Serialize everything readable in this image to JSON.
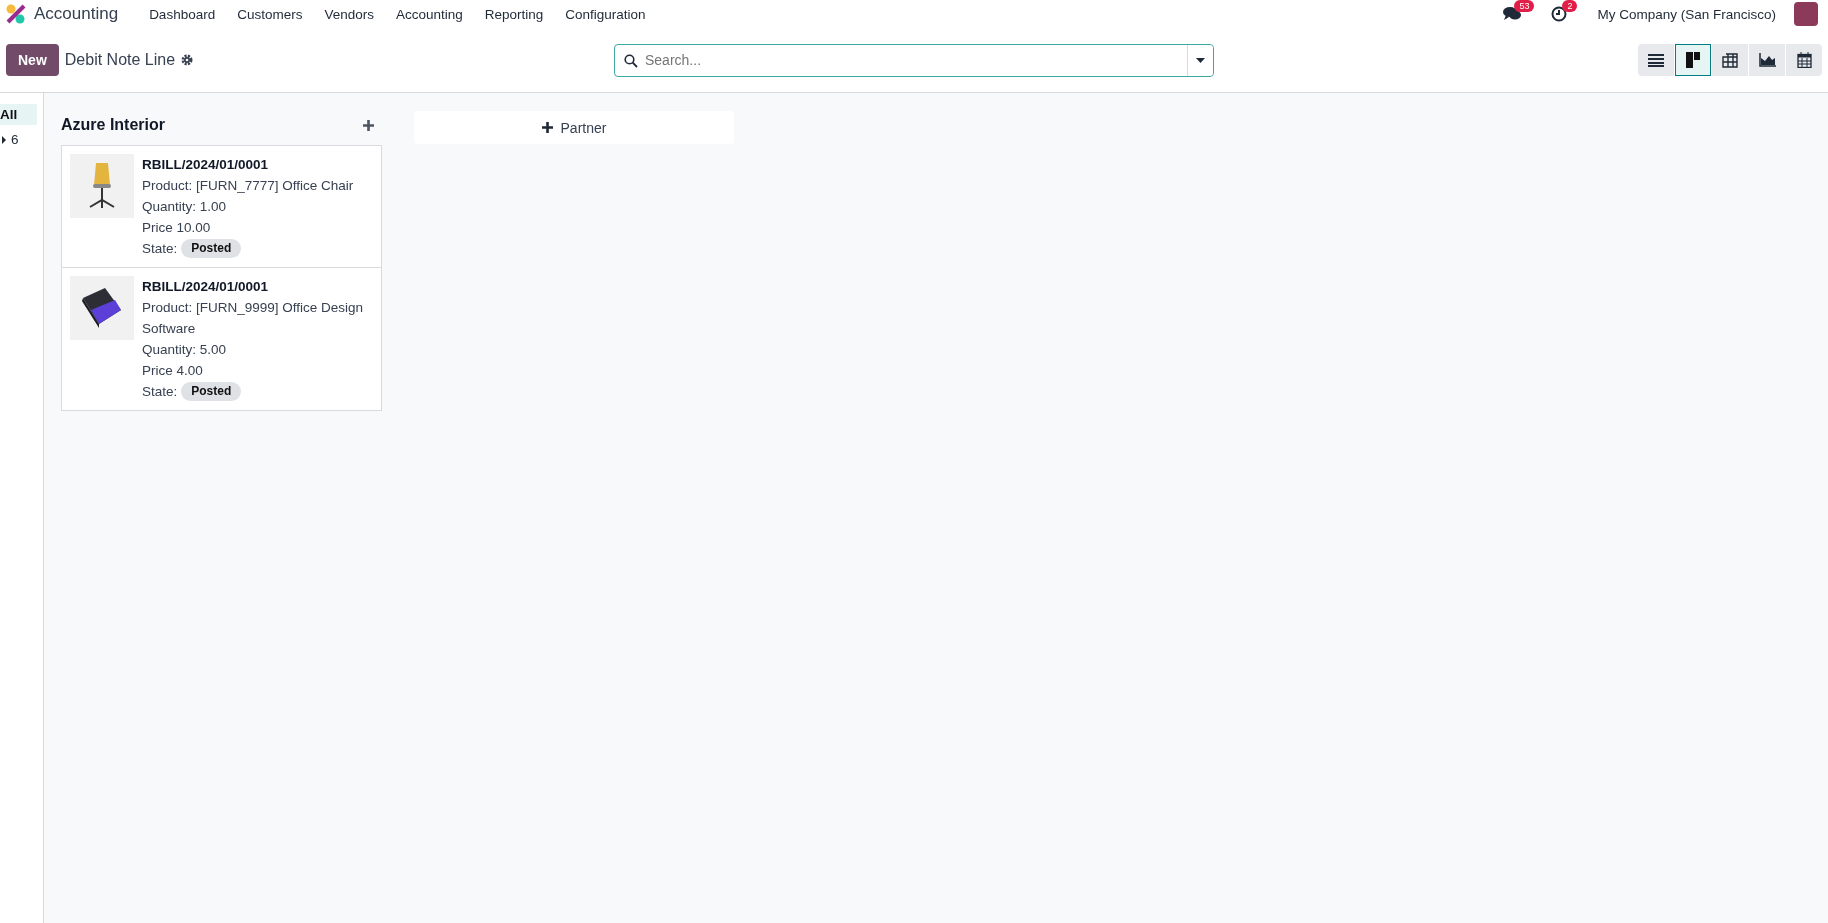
{
  "navbar": {
    "app_name": "Accounting",
    "menu": [
      "Dashboard",
      "Customers",
      "Vendors",
      "Accounting",
      "Reporting",
      "Configuration"
    ],
    "messages_count": "53",
    "activities_count": "2",
    "company": "My Company (San Francisco)"
  },
  "control_panel": {
    "new_button": "New",
    "title": "Debit Note Line",
    "search": {
      "placeholder": "Search..."
    },
    "views": [
      {
        "kind": "list",
        "selected": false
      },
      {
        "kind": "kanban",
        "selected": true
      },
      {
        "kind": "pivot",
        "selected": false
      },
      {
        "kind": "graph",
        "selected": false
      },
      {
        "kind": "calendar",
        "selected": false
      }
    ]
  },
  "sidebar": {
    "items": [
      {
        "label": "All",
        "selected": true,
        "expandable": false
      },
      {
        "label": "6",
        "selected": false,
        "expandable": true
      }
    ]
  },
  "columns": [
    {
      "title": "Azure Interior",
      "cards": [
        {
          "kind": "chair",
          "reference": "RBILL/2024/01/0001",
          "product": "Product: [FURN_7777] Office Chair",
          "quantity": "Quantity: 1.00",
          "price": "Price 10.00",
          "state_label": "State:",
          "state": "Posted"
        },
        {
          "kind": "software",
          "reference": "RBILL/2024/01/0001",
          "product": "Product: [FURN_9999] Office Design Software",
          "quantity": "Quantity: 5.00",
          "price": "Price 4.00",
          "state_label": "State:",
          "state": "Posted"
        }
      ]
    }
  ],
  "add_column_button": "Partner"
}
